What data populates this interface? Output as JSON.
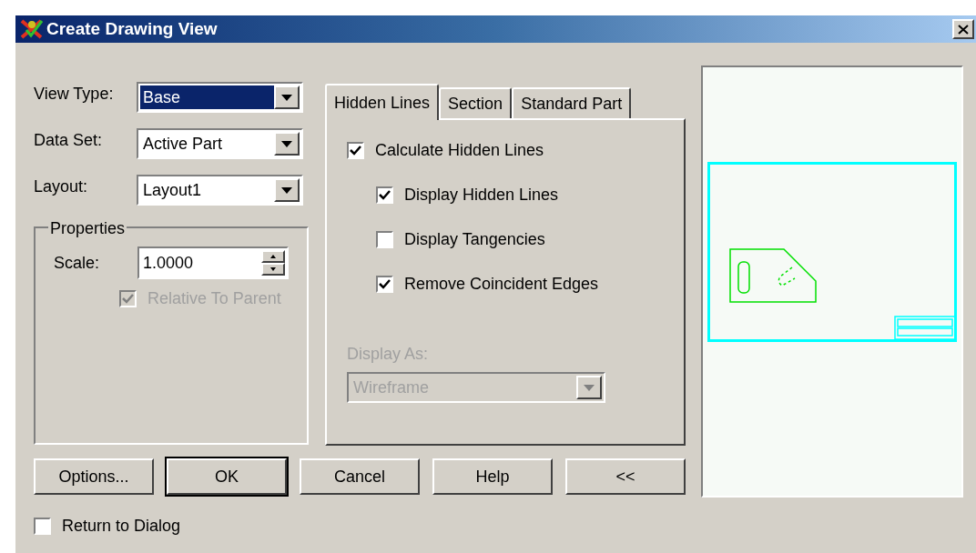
{
  "window": {
    "title": "Create Drawing View"
  },
  "fields": [
    {
      "label": "View Type:",
      "value": "Base",
      "highlighted": true
    },
    {
      "label": "Data Set:",
      "value": "Active Part",
      "highlighted": false
    },
    {
      "label": "Layout:",
      "value": "Layout1",
      "highlighted": false
    }
  ],
  "properties": {
    "title": "Properties",
    "scale_label": "Scale:",
    "scale_value": "1.0000",
    "relative": {
      "label": "Relative To Parent",
      "checked": true,
      "disabled": true
    }
  },
  "tabs": [
    {
      "label": "Hidden Lines",
      "selected": true
    },
    {
      "label": "Section",
      "selected": false
    },
    {
      "label": "Standard Part",
      "selected": false
    }
  ],
  "hidden_lines": [
    {
      "label": "Calculate Hidden Lines",
      "checked": true,
      "children": [
        {
          "label": "Display Hidden Lines",
          "checked": true
        },
        {
          "label": "Display Tangencies",
          "checked": false
        },
        {
          "label": "Remove Coincident Edges",
          "checked": true
        }
      ]
    }
  ],
  "display_as": {
    "label": "Display As:",
    "value": "Wireframe",
    "disabled": true
  },
  "buttons": [
    {
      "label": "Options...",
      "default": false
    },
    {
      "label": "OK",
      "default": true
    },
    {
      "label": "Cancel",
      "default": false
    },
    {
      "label": "Help",
      "default": false
    },
    {
      "label": "<<",
      "default": false
    }
  ],
  "return_to_dialog": {
    "label": "Return to Dialog",
    "checked": false
  }
}
